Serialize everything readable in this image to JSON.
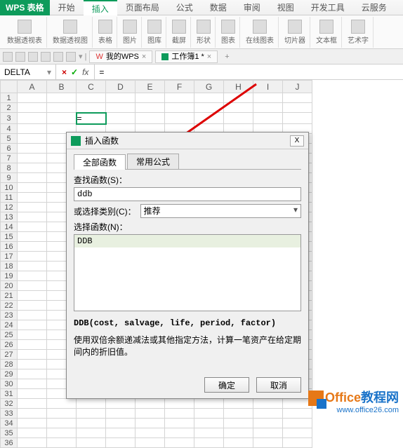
{
  "app_name": "WPS 表格",
  "menu_tabs": [
    "开始",
    "插入",
    "页面布局",
    "公式",
    "数据",
    "审阅",
    "视图",
    "开发工具",
    "云服务"
  ],
  "active_menu_tab": 1,
  "ribbon_groups": [
    "数据透视表",
    "数据透视图",
    "表格",
    "图片",
    "图库",
    "截屏",
    "形状",
    "图表",
    "在线图表",
    "切片器",
    "文本框",
    "艺术字"
  ],
  "doc_tabs": {
    "tab1": "我的WPS",
    "tab2": "工作簿1 *"
  },
  "namebox_value": "DELTA",
  "formula_value": "=",
  "columns": [
    "A",
    "B",
    "C",
    "D",
    "E",
    "F",
    "G",
    "H",
    "I",
    "J"
  ],
  "row_count": 36,
  "active_cell_value": "=",
  "dialog": {
    "title": "插入函数",
    "tabs": [
      "全部函数",
      "常用公式"
    ],
    "search_label": "查找函数(S)：",
    "search_value": "ddb",
    "category_label": "或选择类别(C)：",
    "category_value": "推荐",
    "list_label": "选择函数(N)：",
    "list_items": [
      "DDB"
    ],
    "signature": "DDB(cost, salvage, life, period, factor)",
    "description": "使用双倍余额递减法或其他指定方法，计算一笔资产在给定期间内的折旧值。",
    "ok": "确定",
    "cancel": "取消"
  },
  "watermark": {
    "line1a": "Office",
    "line1b": "教程网",
    "line2": "www.office26.com"
  }
}
